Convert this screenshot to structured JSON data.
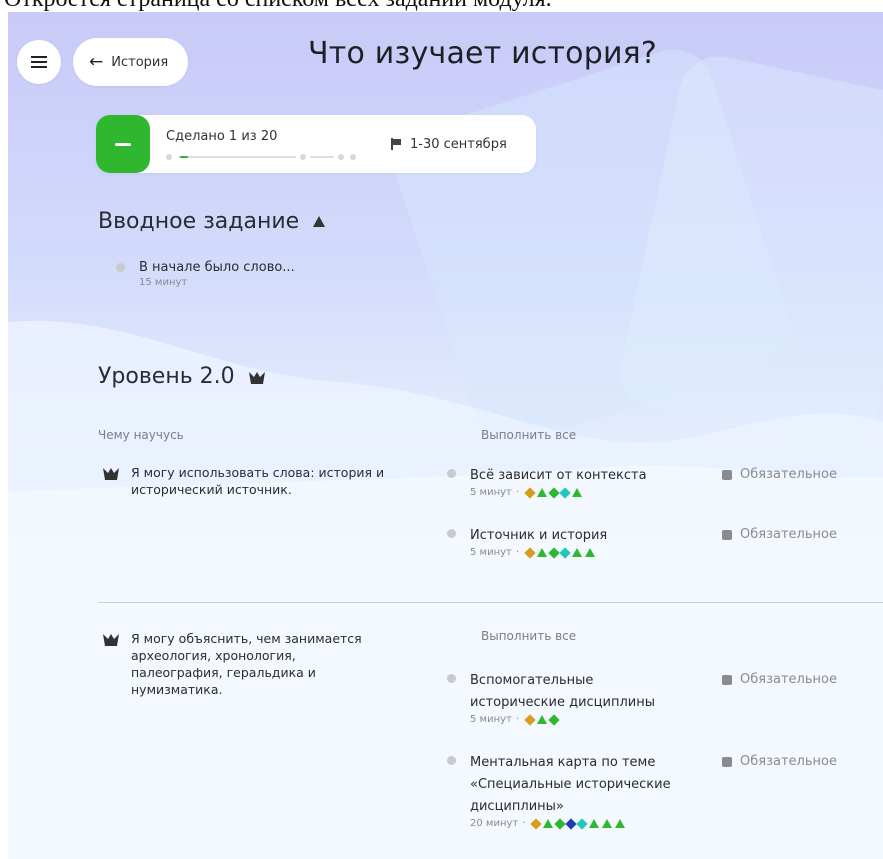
{
  "caption": "Откроется страница со списком всех заданий модуля.",
  "header": {
    "back_label": "История",
    "title": "Что изучает история?"
  },
  "progress": {
    "done_label": "Сделано 1 из 20",
    "done": 1,
    "total": 20,
    "deadline": "1-30 сентября"
  },
  "intro": {
    "title": "Вводное задание",
    "task": {
      "name": "В начале было слово...",
      "duration": "15 минут"
    }
  },
  "level": {
    "title": "Уровень 2.0",
    "learn_header": "Чему научусь",
    "do_all_label": "Выполнить все",
    "groups": [
      {
        "skill": "Я могу использовать слова: история и исторический источник.",
        "tasks": [
          {
            "name": "Всё зависит от контекста",
            "duration": "5 минут",
            "requirement": "Обязательное",
            "marks": [
              "diamond-gold",
              "triangle-green",
              "diamond-green",
              "diamond-teal",
              "triangle-green"
            ]
          },
          {
            "name": "Источник и история",
            "duration": "5 минут",
            "requirement": "Обязательное",
            "marks": [
              "diamond-gold",
              "triangle-green",
              "diamond-green",
              "diamond-teal",
              "triangle-green",
              "triangle-green"
            ]
          }
        ]
      },
      {
        "skill": "Я могу объяснить, чем занимается археология, хронология, палеография, геральдика и нумизматика.",
        "tasks": [
          {
            "name": "Вспомогательные исторические дисциплины",
            "duration": "5 минут",
            "requirement": "Обязательное",
            "marks": [
              "diamond-gold",
              "triangle-green",
              "diamond-green"
            ]
          },
          {
            "name": "Ментальная карта по теме «Специальные исторические дисциплины»",
            "duration": "20 минут",
            "requirement": "Обязательное",
            "marks": [
              "diamond-gold",
              "triangle-green",
              "diamond-green",
              "diamond-navy",
              "diamond-teal",
              "triangle-green",
              "triangle-green",
              "triangle-green"
            ]
          }
        ]
      }
    ]
  },
  "colors": {
    "accent_green": "#2fb82f",
    "gold": "#d69d1d",
    "teal": "#22c7b8",
    "navy": "#1f3fb0"
  },
  "icons": {
    "menu": "hamburger-icon",
    "back": "arrow-left-icon",
    "collapse": "minus-icon",
    "deadline": "flag-icon",
    "intro_level": "triangle-up-icon",
    "skill": "crown-icon",
    "requirement": "cube-icon"
  }
}
